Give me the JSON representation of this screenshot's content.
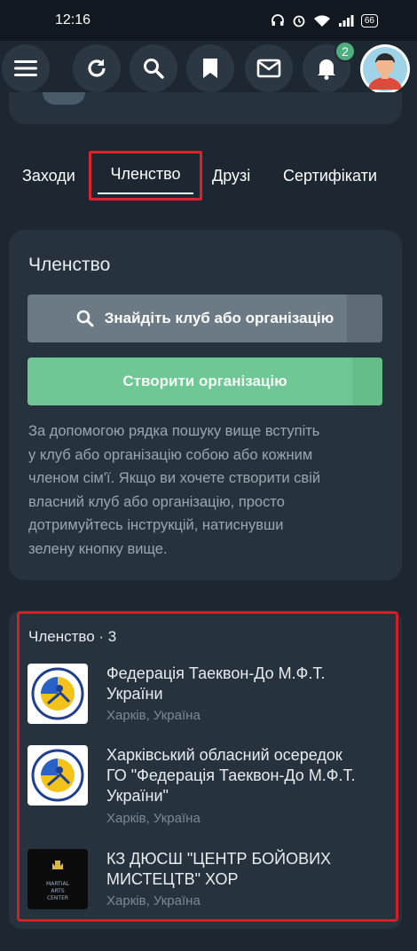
{
  "status_bar": {
    "time": "12:16",
    "battery": "66"
  },
  "top_bar": {
    "notification_count": "2"
  },
  "tabs": [
    {
      "label": "Заходи"
    },
    {
      "label": "Членство"
    },
    {
      "label": "Друзі"
    },
    {
      "label": "Сертифікати"
    }
  ],
  "membership_card": {
    "title": "Членство",
    "search_button": "Знайдіть клуб або організацію",
    "create_button": "Створити організацію",
    "help_lines": [
      "За допомогою рядка пошуку вище вступіть",
      "у клуб або організацію собою або кожним",
      "членом сім'ї. Якщо ви хочете створити свій",
      "власний клуб або організацію, просто",
      "дотримуйтесь інструкцій, натиснувши",
      "зелену кнопку вище."
    ]
  },
  "membership_list": {
    "title": "Членство · 3",
    "items": [
      {
        "name_lines": [
          "Федерація Таеквон-До М.Ф.Т.",
          "України"
        ],
        "location": "Харків, Україна"
      },
      {
        "name_lines": [
          "Харківський обласний осередок",
          "ГО \"Федерація Таеквон-До М.Ф.Т.",
          "України\""
        ],
        "location": "Харків, Україна"
      },
      {
        "name_lines": [
          "КЗ ДЮСШ \"ЦЕНТР БОЙОВИХ",
          "МИСТЕЦТВ\" ХОР"
        ],
        "location": "Харків, Україна",
        "logo_text": [
          "MARTIAL",
          "ARTS",
          "CENTER"
        ]
      }
    ]
  },
  "colors": {
    "background": "#1c2731",
    "card": "#26333e",
    "accent_green": "#6fc795",
    "highlight_red": "#e0202a"
  }
}
